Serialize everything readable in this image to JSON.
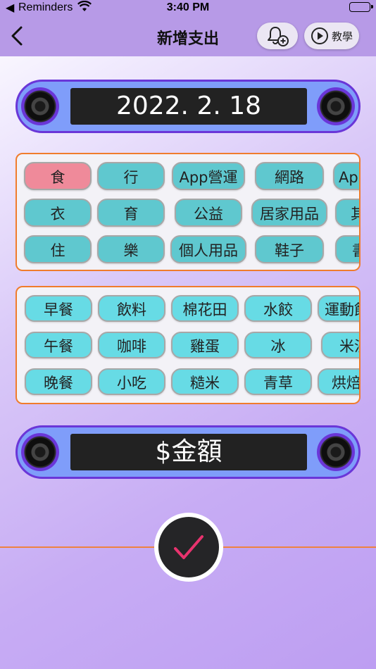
{
  "status": {
    "app_label": "Reminders",
    "time": "3:40 PM"
  },
  "nav": {
    "title": "新增支出",
    "tutorial_label": "教學"
  },
  "date_display": "2022. 2. 18",
  "categories": [
    [
      "食",
      "行",
      "App營運",
      "網路",
      "Ap"
    ],
    [
      "衣",
      "育",
      "公益",
      "居家用品",
      "其"
    ],
    [
      "住",
      "樂",
      "個人用品",
      "鞋子",
      "書"
    ]
  ],
  "subcategories": [
    [
      "早餐",
      "飲料",
      "棉花田",
      "水餃",
      "運動飲"
    ],
    [
      "午餐",
      "咖啡",
      "雞蛋",
      "冰",
      "米沙"
    ],
    [
      "晚餐",
      "小吃",
      "糙米",
      "青草",
      "烘焙"
    ]
  ],
  "amount_placeholder": "$金額",
  "colors": {
    "accent_purple": "#6a36d8",
    "chip_teal": "#5fc8cf",
    "chip_selected": "#ef8a9a",
    "border_orange": "#f07c2c",
    "check_pink": "#e8336e"
  }
}
